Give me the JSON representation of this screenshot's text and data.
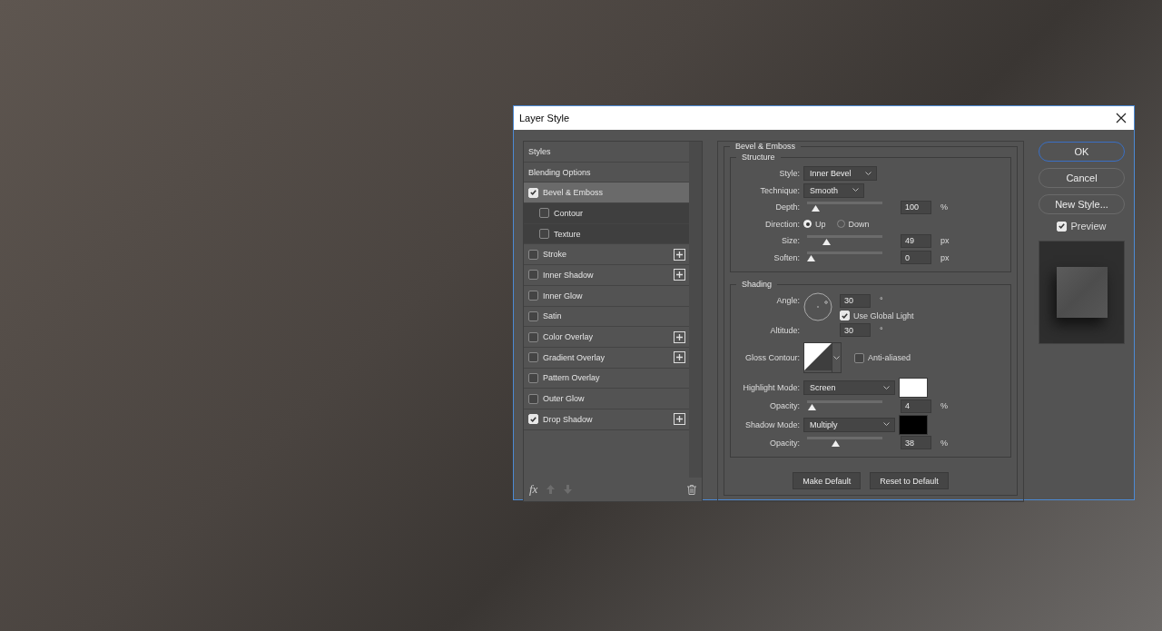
{
  "window": {
    "title": "Layer Style"
  },
  "effects_list": [
    {
      "label": "Styles",
      "kind": "header",
      "selected": false
    },
    {
      "label": "Blending Options",
      "kind": "header",
      "selected": false
    },
    {
      "label": "Bevel & Emboss",
      "kind": "effect",
      "checked": true,
      "selected": true,
      "addable": false
    },
    {
      "label": "Contour",
      "kind": "sub",
      "checked": false,
      "selected": false,
      "addable": false
    },
    {
      "label": "Texture",
      "kind": "sub",
      "checked": false,
      "selected": false,
      "addable": false
    },
    {
      "label": "Stroke",
      "kind": "effect",
      "checked": false,
      "selected": false,
      "addable": true
    },
    {
      "label": "Inner Shadow",
      "kind": "effect",
      "checked": false,
      "selected": false,
      "addable": true
    },
    {
      "label": "Inner Glow",
      "kind": "effect",
      "checked": false,
      "selected": false,
      "addable": false
    },
    {
      "label": "Satin",
      "kind": "effect",
      "checked": false,
      "selected": false,
      "addable": false
    },
    {
      "label": "Color Overlay",
      "kind": "effect",
      "checked": false,
      "selected": false,
      "addable": true
    },
    {
      "label": "Gradient Overlay",
      "kind": "effect",
      "checked": false,
      "selected": false,
      "addable": true
    },
    {
      "label": "Pattern Overlay",
      "kind": "effect",
      "checked": false,
      "selected": false,
      "addable": false
    },
    {
      "label": "Outer Glow",
      "kind": "effect",
      "checked": false,
      "selected": false,
      "addable": false
    },
    {
      "label": "Drop Shadow",
      "kind": "effect",
      "checked": true,
      "selected": false,
      "addable": true
    }
  ],
  "list_toolbar": {
    "fx": "fx"
  },
  "panel": {
    "title": "Bevel & Emboss",
    "structure": {
      "title": "Structure",
      "style_label": "Style:",
      "style": "Inner Bevel",
      "technique_label": "Technique:",
      "technique": "Smooth",
      "depth": {
        "label": "Depth:",
        "level": 0.07,
        "value": "100",
        "unit": "%"
      },
      "direction_label": "Direction:",
      "directions": [
        {
          "label": "Up",
          "selected": true
        },
        {
          "label": "Down",
          "selected": false
        }
      ],
      "size": {
        "label": "Size:",
        "level": 0.23,
        "value": "49",
        "unit": "px"
      },
      "soften": {
        "label": "Soften:",
        "level": 0,
        "value": "0",
        "unit": "px"
      }
    },
    "shading": {
      "title": "Shading",
      "angle_label": "Angle:",
      "angle": "30",
      "angle_unit": "°",
      "global_light": {
        "label": "Use Global Light",
        "checked": true
      },
      "altitude_label": "Altitude:",
      "altitude": "30",
      "altitude_unit": "°",
      "gloss_label": "Gloss Contour:",
      "anti_aliased": {
        "label": "Anti-aliased",
        "checked": false
      },
      "highlight": {
        "label": "Highlight Mode:",
        "mode": "Screen",
        "color": "#ffffff"
      },
      "highlight_opacity": {
        "label": "Opacity:",
        "level": 0.02,
        "value": "4",
        "unit": "%"
      },
      "shadow": {
        "label": "Shadow Mode:",
        "mode": "Multiply",
        "color": "#000000"
      },
      "shadow_opacity": {
        "label": "Opacity:",
        "level": 0.36,
        "value": "38",
        "unit": "%"
      }
    },
    "buttons": [
      "Make Default",
      "Reset to Default"
    ]
  },
  "actions": [
    {
      "label": "OK",
      "default": true
    },
    {
      "label": "Cancel",
      "default": false
    },
    {
      "label": "New Style...",
      "default": false
    }
  ],
  "preview": {
    "label": "Preview",
    "checked": true
  }
}
